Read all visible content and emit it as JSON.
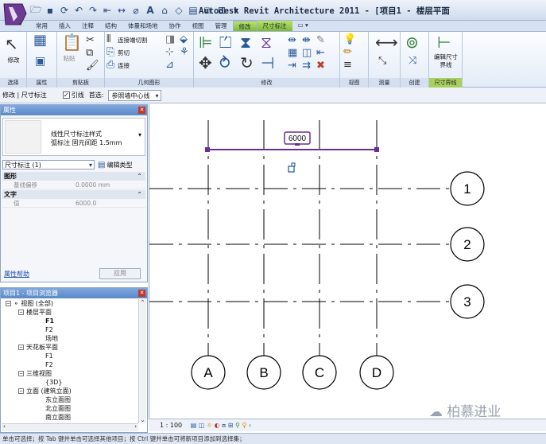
{
  "window": {
    "title": "Autodesk Revit Architecture 2011 - [项目1 - 楼层平面"
  },
  "ribbon_tabs": [
    "常用",
    "插入",
    "注释",
    "结构",
    "体量和场地",
    "协作",
    "视图",
    "管理",
    "修改",
    "尺寸标注"
  ],
  "ribbon": {
    "modify_label": "修改",
    "clipboard": {
      "paste_label": "粘贴"
    },
    "geometry": {
      "join_cut": "连接端切割",
      "cut": "剪切",
      "join": "连接"
    },
    "edit_witness": "编辑尺寸界线",
    "panels": [
      "选择",
      "属性",
      "剪贴板",
      "几何图形",
      "修改",
      "视图",
      "测量",
      "创建",
      "尺寸界线"
    ]
  },
  "options_bar": {
    "context": "修改 | 尺寸标注",
    "lead_label": "引线",
    "lead_checked": "✓",
    "prefer_label": "首选:",
    "prefer_value": "参照墙中心线"
  },
  "properties": {
    "title": "属性",
    "type_line1": "线性尺寸标注样式",
    "type_line2": "弧标注 固元间距 1.5mm",
    "instance": "尺寸标注 (1)",
    "edit_type": "编辑类型",
    "groups": [
      {
        "name": "图形",
        "rows": [
          {
            "k": "基线偏移",
            "v": "0.0000 mm"
          }
        ]
      },
      {
        "name": "文字",
        "rows": [
          {
            "k": "值",
            "v": "6000.0"
          }
        ]
      }
    ],
    "help_link": "属性帮助",
    "apply_label": "应用"
  },
  "browser": {
    "title": "项目1 - 项目浏览器",
    "tree": [
      {
        "text": "视图 (全部)",
        "box": "−",
        "icon": "⚬",
        "bold": false
      },
      {
        "text": "楼层平面",
        "box": "−",
        "bold": false
      },
      {
        "text": "F1",
        "bold": true
      },
      {
        "text": "F2",
        "bold": false
      },
      {
        "text": "场地",
        "bold": false
      },
      {
        "text": "天花板平面",
        "box": "−",
        "bold": false
      },
      {
        "text": "F1",
        "bold": false
      },
      {
        "text": "F2",
        "bold": false
      },
      {
        "text": "三维视图",
        "box": "−",
        "bold": false
      },
      {
        "text": "{3D}",
        "bold": false
      },
      {
        "text": "立面 (建筑立面)",
        "box": "−",
        "bold": false
      },
      {
        "text": "东立面图",
        "bold": false
      },
      {
        "text": "北立面图",
        "bold": false
      },
      {
        "text": "南立面图",
        "bold": false
      }
    ]
  },
  "canvas": {
    "dimension_value": "6000",
    "grid_rows": [
      "1",
      "2",
      "3"
    ],
    "grid_cols": [
      "A",
      "B",
      "C",
      "D"
    ]
  },
  "view_control": {
    "scale": "1 : 100"
  },
  "statusbar": {
    "text": "单击可选择；按 Tab 键并单击可选择其他项目；按 Ctrl 键并单击可将新项目添加到选择集；"
  },
  "watermark": "柏慕进业",
  "colors": {
    "dimension": "#6a2d91",
    "ribbon_context": "#8fc24a",
    "panel_header": "#5b88c8"
  }
}
